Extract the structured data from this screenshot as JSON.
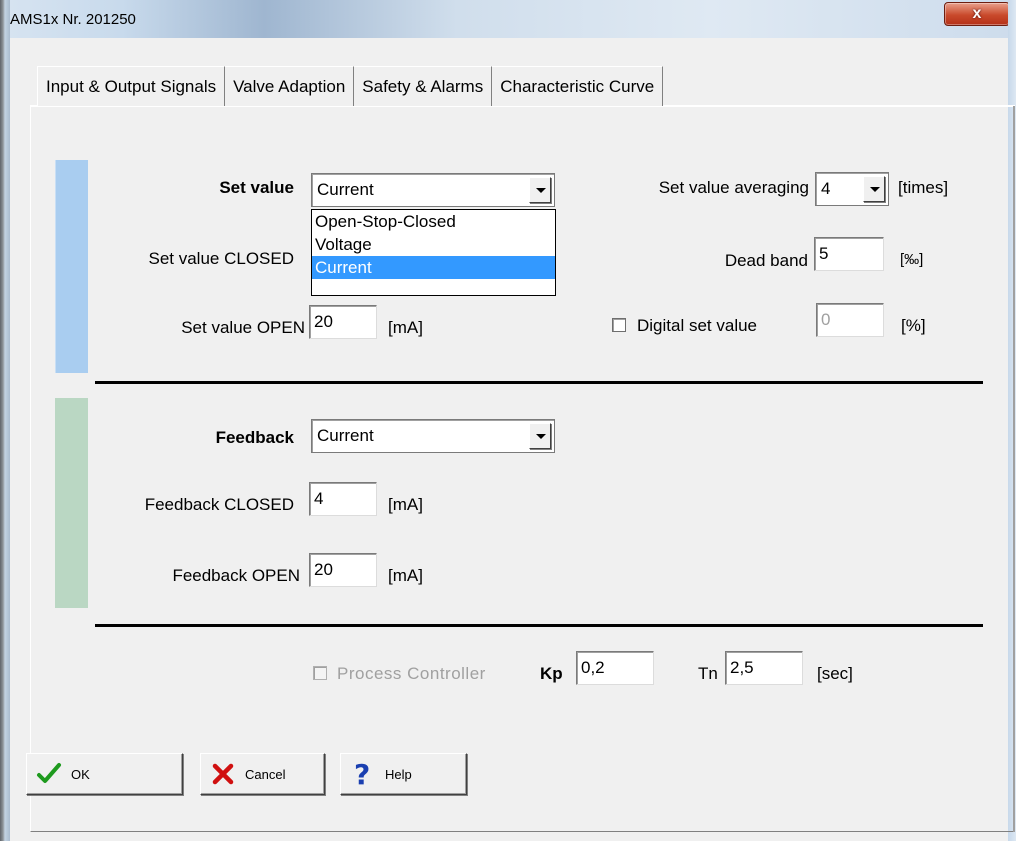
{
  "window": {
    "title": "AMS1x Nr. 201250",
    "close_glyph": "x"
  },
  "tabs": [
    {
      "label": "Input & Output Signals",
      "active": true
    },
    {
      "label": "Valve Adaption",
      "active": false
    },
    {
      "label": "Safety & Alarms",
      "active": false
    },
    {
      "label": "Characteristic Curve",
      "active": false
    }
  ],
  "set_value": {
    "label": "Set value",
    "selected": "Current",
    "options": [
      "Open-Stop-Closed",
      "Voltage",
      "Current"
    ],
    "closed_label": "Set value CLOSED",
    "open_label": "Set value OPEN",
    "open_value": "20",
    "open_unit": "[mA]",
    "averaging_label": "Set value averaging",
    "averaging_value": "4",
    "averaging_unit": "[times]",
    "dead_band_label": "Dead band",
    "dead_band_value": "5",
    "dead_band_unit": "[‰]",
    "digital_label": "Digital set value",
    "digital_value": "0",
    "digital_unit": "[%]",
    "digital_checked": false
  },
  "feedback": {
    "label": "Feedback",
    "selected": "Current",
    "closed_label": "Feedback CLOSED",
    "closed_value": "4",
    "closed_unit": "[mA]",
    "open_label": "Feedback OPEN",
    "open_value": "20",
    "open_unit": "[mA]"
  },
  "controller": {
    "process_label": "Process Controller",
    "process_enabled": false,
    "kp_label": "Kp",
    "kp_value": "0,2",
    "tn_label": "Tn",
    "tn_value": "2,5",
    "tn_unit": "[sec]"
  },
  "buttons": {
    "ok": "OK",
    "cancel": "Cancel",
    "help": "Help"
  },
  "colors": {
    "set_value_bar": "#a9cdf0",
    "feedback_bar": "#bad7c3",
    "selection": "#3399ff",
    "ok_icon": "#1e9a1e",
    "cancel_icon": "#d01010",
    "help_icon": "#1a3fb0"
  },
  "icons": {
    "ok": "checkmark-icon",
    "cancel": "x-mark-icon",
    "help": "question-mark-icon"
  }
}
